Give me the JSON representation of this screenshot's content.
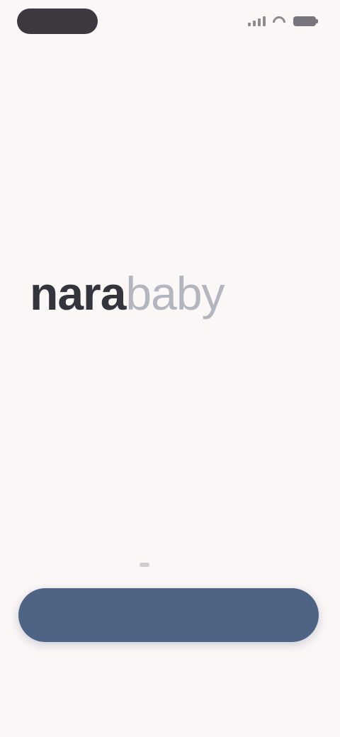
{
  "status_bar": {
    "time_pill": "",
    "icons": [
      "signal-icon",
      "wifi-icon",
      "battery-icon"
    ]
  },
  "logo": {
    "strong": "nara",
    "light": "baby"
  },
  "actions": {
    "primary_button_label": "",
    "footer_text": ""
  },
  "colors": {
    "background": "#fcf7f7",
    "logo_dark": "#34343c",
    "logo_light": "#b3b5bf",
    "button": "#4f6385"
  }
}
